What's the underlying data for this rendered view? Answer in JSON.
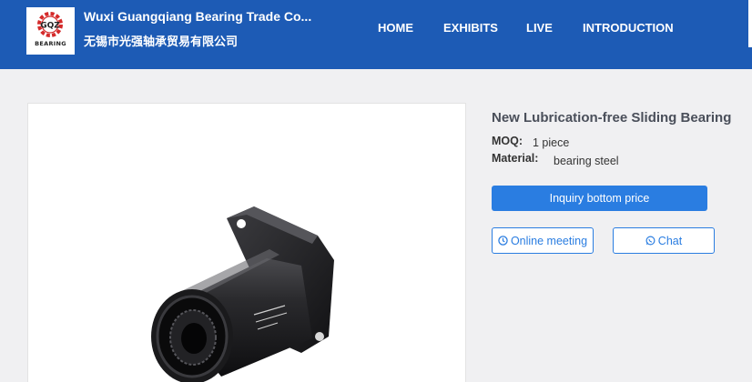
{
  "header": {
    "logo_text": "BEARING",
    "logo_mark": "GQZ",
    "company_name": "Wuxi Guangqiang Bearing Trade Co...",
    "company_name_cn": "无锡市光强轴承贸易有限公司",
    "nav": [
      "HOME",
      "EXHIBITS",
      "LIVE",
      "INTRODUCTION"
    ]
  },
  "product": {
    "title": "New Lubrication-free Sliding Bearing",
    "moq_label": "MOQ:",
    "moq_value": "1 piece",
    "material_label": "Material:",
    "material_value": "bearing steel"
  },
  "actions": {
    "inquiry": "Inquiry bottom price",
    "online_meeting": "Online meeting",
    "chat": "Chat"
  },
  "colors": {
    "header_bg": "#1d5bb5",
    "accent": "#2a7de1",
    "page_bg": "#f0f0f2"
  },
  "icons": [
    "gear-logo-icon",
    "clock-icon",
    "whatsapp-icon"
  ]
}
